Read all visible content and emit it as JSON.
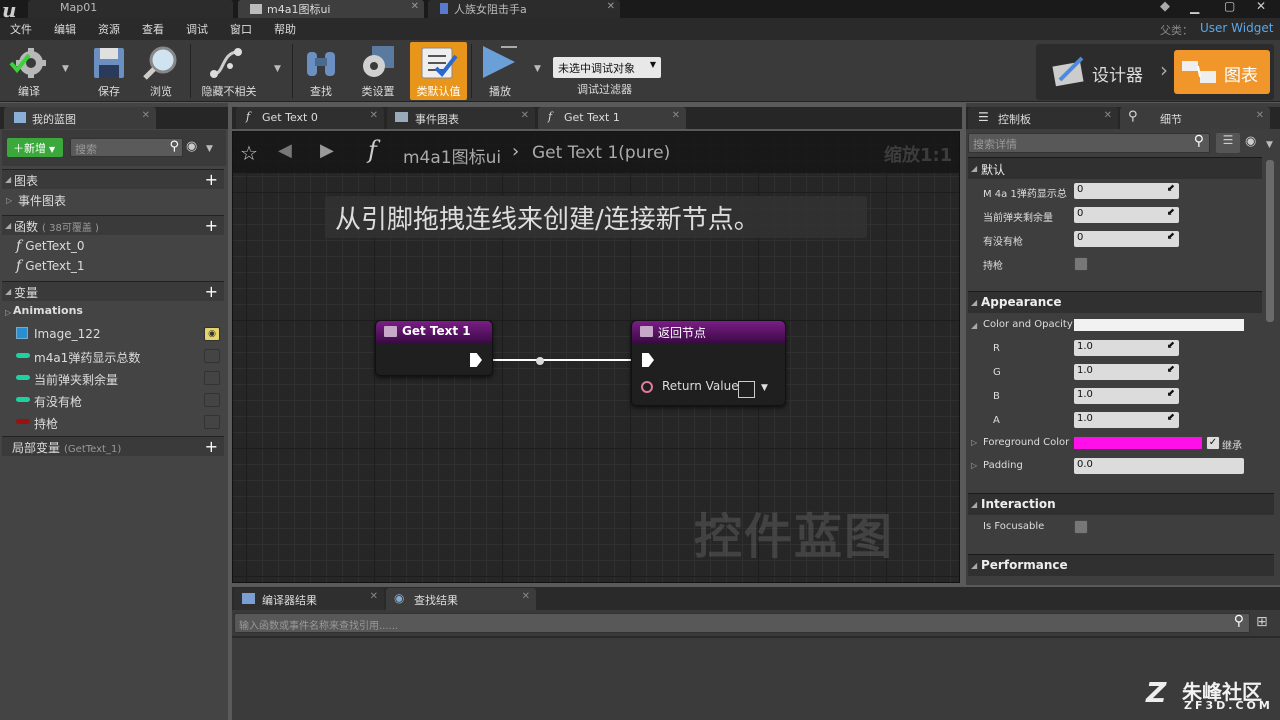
{
  "titlebar": {
    "logo": "u",
    "tabs": [
      {
        "label": "Map01"
      },
      {
        "label": "m4a1图标ui"
      },
      {
        "label": "人族女阻击手a"
      }
    ]
  },
  "menu": [
    "文件",
    "编辑",
    "资源",
    "查看",
    "调试",
    "窗口",
    "帮助"
  ],
  "parent_class": {
    "label": "父类：",
    "value": "User Widget"
  },
  "toolbar": {
    "compile": "编译",
    "save": "保存",
    "browse": "浏览",
    "hide_unrelated": "隐藏不相关",
    "find": "查找",
    "class_settings": "类设置",
    "class_defaults": "类默认值",
    "play": "播放",
    "debug_select": "未选中调试对象",
    "debug_filter": "调试过滤器",
    "designer": "设计器",
    "graph": "图表"
  },
  "my_blueprint": {
    "tab": "我的蓝图",
    "new_btn": "新增",
    "search_placeholder": "搜索",
    "graphs_cat": "图表",
    "event_graph": "事件图表",
    "functions_cat": "函数",
    "functions_note": "( 38可覆盖 )",
    "functions": [
      "GetText_0",
      "GetText_1"
    ],
    "variables_cat": "变量",
    "animations": "Animations",
    "variables": [
      {
        "name": "Image_122",
        "color": "#2a8fd0"
      },
      {
        "name": "m4a1弹药显示总数",
        "color": "#1ed1a0"
      },
      {
        "name": "当前弹夹剩余量",
        "color": "#1ed1a0"
      },
      {
        "name": "有没有枪",
        "color": "#1ed1a0"
      },
      {
        "name": "持枪",
        "color": "#9c1010"
      }
    ],
    "local_vars": "局部变量",
    "local_vars_scope": "(GetText_1)"
  },
  "graph_tabs": [
    {
      "label": "Get Text 0"
    },
    {
      "label": "事件图表"
    },
    {
      "label": "Get Text 1"
    }
  ],
  "graph": {
    "breadcrumb_root": "m4a1图标ui",
    "breadcrumb_sep": "›",
    "breadcrumb_current": "Get Text 1(pure)",
    "zoom": "缩放1:1",
    "hint": "从引脚拖拽连线来创建/连接新节点。",
    "watermark": "控件蓝图",
    "node_entry": "Get Text 1",
    "node_return": "返回节点",
    "return_value": "Return Value"
  },
  "bottom": {
    "tab_compiler": "编译器结果",
    "tab_find": "查找结果",
    "search_placeholder": "输入函数或事件名称来查找引用......"
  },
  "right_panel": {
    "tab_palette": "控制板",
    "tab_details": "细节",
    "search_placeholder": "搜索详情",
    "default_section": "默认",
    "default_props": [
      {
        "label": "M 4a 1弹药显示总",
        "value": "0"
      },
      {
        "label": "当前弹夹剩余量",
        "value": "0"
      },
      {
        "label": "有没有枪",
        "value": "0"
      }
    ],
    "has_gun": "持枪",
    "appearance": "Appearance",
    "color_opacity": "Color and Opacity",
    "rgba": [
      {
        "label": "R",
        "value": "1.0"
      },
      {
        "label": "G",
        "value": "1.0"
      },
      {
        "label": "B",
        "value": "1.0"
      },
      {
        "label": "A",
        "value": "1.0"
      }
    ],
    "foreground_color": "Foreground Color",
    "inherit": "继承",
    "padding": "Padding",
    "padding_value": "0.0",
    "interaction": "Interaction",
    "is_focusable": "Is Focusable",
    "performance": "Performance"
  },
  "site_watermark": {
    "name": "朱峰社区",
    "url": "ZF3D.COM"
  },
  "colors": {
    "accent_orange": "#e8951c",
    "node_purple": "#7a1d86",
    "foreground_magenta": "#ff10e8"
  }
}
